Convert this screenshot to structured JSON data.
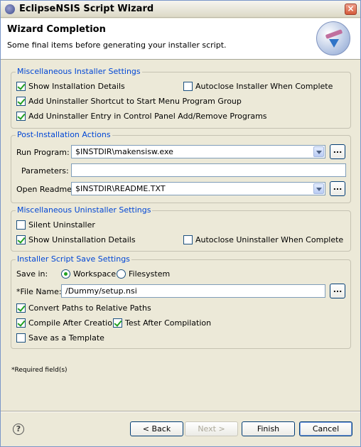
{
  "window": {
    "title": "EclipseNSIS Script Wizard",
    "close_symbol": "×",
    "app_icon": "eclipse-nsis-icon"
  },
  "header": {
    "title": "Wizard Completion",
    "description": "Some final items before generating your installer script.",
    "logo_icon": "wizard-logo-icon"
  },
  "misc_installer": {
    "legend": "Miscellaneous Installer Settings",
    "show_details": {
      "label": "Show Installation Details",
      "checked": true
    },
    "autoclose": {
      "label": "Autoclose Installer When Complete",
      "checked": false
    },
    "uninstaller_shortcut": {
      "label": "Add Uninstaller Shortcut to Start Menu Program Group",
      "checked": true
    },
    "uninstaller_entry": {
      "label": "Add Uninstaller Entry in Control Panel Add/Remove Programs",
      "checked": true
    }
  },
  "post_install": {
    "legend": "Post-Installation Actions",
    "run_program_label": "Run Program:",
    "run_program_value": "$INSTDIR\\makensisw.exe",
    "parameters_label": "Parameters:",
    "parameters_value": "",
    "open_readme_label": "Open Readme:",
    "open_readme_value": "$INSTDIR\\README.TXT",
    "browse_label": "..."
  },
  "misc_uninstaller": {
    "legend": "Miscellaneous Uninstaller Settings",
    "silent": {
      "label": "Silent Uninstaller",
      "checked": false
    },
    "show_details": {
      "label": "Show Uninstallation Details",
      "checked": true
    },
    "autoclose": {
      "label": "Autoclose Uninstaller When Complete",
      "checked": false
    }
  },
  "save_settings": {
    "legend": "Installer Script Save Settings",
    "save_in_label": "Save in:",
    "workspace": {
      "label": "Workspace",
      "selected": true
    },
    "filesystem": {
      "label": "Filesystem",
      "selected": false
    },
    "file_name_label": "*File Name:",
    "file_name_value": "/Dummy/setup.nsi",
    "browse_label": "...",
    "convert_paths": {
      "label": "Convert Paths to Relative Paths",
      "checked": true
    },
    "compile_after": {
      "label": "Compile After Creation",
      "checked": true
    },
    "test_after": {
      "label": "Test After Compilation",
      "checked": true
    },
    "save_template": {
      "label": "Save as a Template",
      "checked": false
    }
  },
  "required_note": "*Required field(s)",
  "footer": {
    "help_symbol": "?",
    "back": "< Back",
    "next": "Next >",
    "finish": "Finish",
    "cancel": "Cancel"
  }
}
